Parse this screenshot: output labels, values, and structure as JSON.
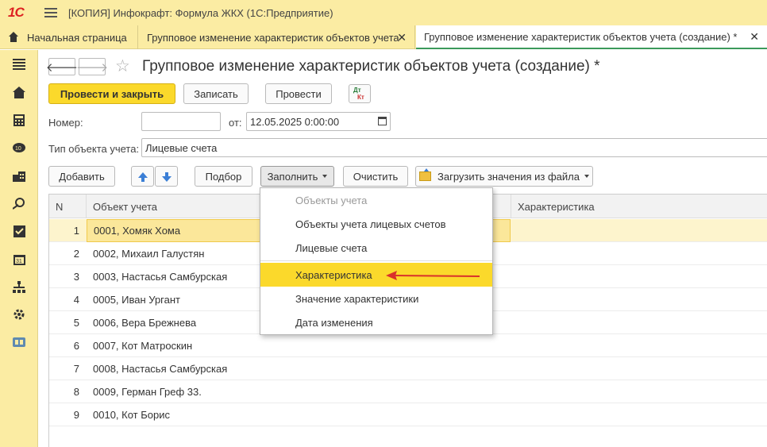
{
  "app": {
    "window_title": "[КОПИЯ] Инфокрафт: Формула ЖКХ  (1С:Предприятие)",
    "logo_text": "1С"
  },
  "tabs": [
    {
      "label": "Начальная страница"
    },
    {
      "label": "Групповое изменение характеристик объектов учета"
    },
    {
      "label": "Групповое изменение характеристик объектов учета (создание) *"
    }
  ],
  "document": {
    "title": "Групповое изменение характеристик объектов учета (создание) *"
  },
  "toolbar": {
    "post_close": "Провести и закрыть",
    "save": "Записать",
    "post": "Провести",
    "dt_label": "Дт",
    "kt_label": "Кт"
  },
  "form": {
    "number_label": "Номер:",
    "number_value": "",
    "date_label": "от:",
    "date_value": "12.05.2025  0:00:00",
    "object_type_label": "Тип объекта учета:",
    "object_type_value": "Лицевые счета"
  },
  "table_toolbar": {
    "add": "Добавить",
    "pick": "Подбор",
    "fill": "Заполнить",
    "clear": "Очистить",
    "load": "Загрузить значения из файла"
  },
  "table": {
    "columns": [
      "N",
      "Объект учета",
      "Характеристика"
    ],
    "rows": [
      {
        "n": "1",
        "object": "0001, Хомяк Хома"
      },
      {
        "n": "2",
        "object": "0002, Михаил Галустян"
      },
      {
        "n": "3",
        "object": "0003, Настасья Самбурская"
      },
      {
        "n": "4",
        "object": "0005, Иван Ургант"
      },
      {
        "n": "5",
        "object": "0006, Вера Брежнева"
      },
      {
        "n": "6",
        "object": "0007, Кот Матроскин"
      },
      {
        "n": "7",
        "object": "0008, Настасья Самбурская"
      },
      {
        "n": "8",
        "object": "0009, Герман Греф 33."
      },
      {
        "n": "9",
        "object": "0010, Кот Борис"
      }
    ]
  },
  "fill_menu": {
    "items": [
      {
        "label": "Объекты учета",
        "disabled": true
      },
      {
        "label": "Объекты учета лицевых счетов"
      },
      {
        "label": "Лицевые счета"
      },
      {
        "label": "Характеристика",
        "highlighted": true
      },
      {
        "label": "Значение характеристики"
      },
      {
        "label": "Дата изменения"
      }
    ]
  },
  "colors": {
    "accent_yellow": "#fbd92b",
    "titlebar": "#fbeca3",
    "annotation_arrow": "#d9312b"
  }
}
